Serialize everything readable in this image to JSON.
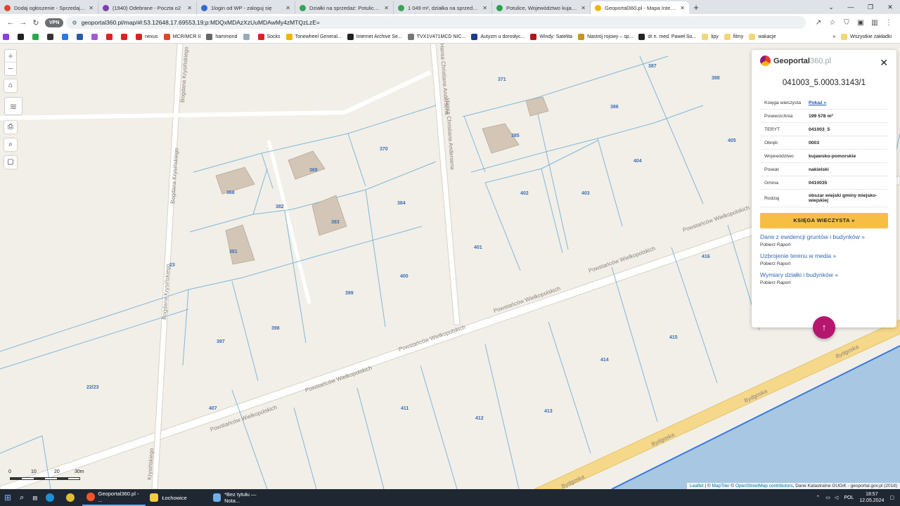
{
  "tabs": [
    {
      "title": "Dodaj ogłoszenie - Sprzedajemy",
      "color": "#e0472a"
    },
    {
      "title": "(1940) Odebrane - Poczta o2",
      "color": "#7a3fb0"
    },
    {
      "title": "1login od WP - zaloguj się",
      "color": "#2f6bd0"
    },
    {
      "title": "Działki na sprzedaż: Potulice, Na",
      "color": "#3aa35a"
    },
    {
      "title": "1 049 m², działka na sprzedaż -",
      "color": "#3aa35a"
    },
    {
      "title": "Potulice, Województwo kujawsk",
      "color": "#2aa44b"
    },
    {
      "title": "Geoportal360.pl - Mapa Interakt",
      "color": "#f4b400"
    }
  ],
  "address": "geoportal360.pl/map/#l:53.12648,17.69553,19;p:MDQxMDAzXzUuMDAwMy4zMTQzLzE=",
  "bookmarks": [
    "nexus",
    "MCR/MCR II",
    "hammond",
    "Socks",
    "Tonewheel General...",
    "Internet Archive Se...",
    "TVX1V471MCD NIC...",
    "Autyzm u dorosłyc...",
    "Windy: Satelita",
    "Nastrój rojowy – sp...",
    "dr n. med. Paweł So...",
    "lipy",
    "filmy",
    "wakacje",
    "Wszystkie zakładki"
  ],
  "map": {
    "plots": [
      "371",
      "387",
      "388",
      "386",
      "385",
      "405",
      "370",
      "369",
      "368",
      "404",
      "382",
      "384",
      "402",
      "403",
      "383",
      "401",
      "381",
      "23",
      "416",
      "400",
      "399",
      "398",
      "397",
      "415",
      "414",
      "22/23",
      "407",
      "411",
      "412",
      "413"
    ],
    "streets": [
      "Bogdana Krysińskiego",
      "Bogdana Krysińskiego",
      "Bogdana Krysińskiego",
      "Hansa Christiana Andersena",
      "Hansa Christiana Andersena",
      "Powstańców Wielkopolskich",
      "Powstańców Wielkopolskich",
      "Powstańców Wielkopolskich",
      "Powstańców Wielkopolskich",
      "Powstańców Wielkopolskich",
      "Powstańców Wielkopolskich",
      "Bydgoska",
      "Bydgoska",
      "Bydgoska",
      "Bydgoska",
      "Krysińskiego"
    ],
    "scale": [
      "0",
      "10",
      "20",
      "30m"
    ],
    "attribution": {
      "leaflet": "Leaflet",
      "mid": " | © ",
      "maptiler": "MapTiler",
      "mid2": " © ",
      "osm": "OpenStreetMap contributors",
      "rest": ", Dane Katastralne GUGiK - geoportal.gov.pl (2018)"
    }
  },
  "panel": {
    "logo": "Geoportal",
    "logo_num": "360",
    "logo_tld": ".pl",
    "id": "041003_5.0003.3143/1",
    "rows": [
      {
        "k": "Księga wieczysta",
        "v": "Pokaż »",
        "link": true
      },
      {
        "k": "Powierzchnia",
        "v": "199 578 m²"
      },
      {
        "k": "TERYT",
        "v": "041003_5"
      },
      {
        "k": "Obręb",
        "v": "0003"
      },
      {
        "k": "Województwo",
        "v": "kujawsko-pomorskie"
      },
      {
        "k": "Powiat",
        "v": "nakielski"
      },
      {
        "k": "Gmina",
        "v": "0410035"
      },
      {
        "k": "Rodzaj",
        "v": "obszar wiejski gminy miejsko-wiejskiej"
      }
    ],
    "button": "KSIĘGA WIECZYSTA »",
    "links": [
      {
        "title": "Dane z ewidencji gruntów i budynków »",
        "sub": "Pobierz Raport"
      },
      {
        "title": "Uzbrojenie terenu w media »",
        "sub": "Pobierz Raport"
      },
      {
        "title": "Wymiary działki i budynków »",
        "sub": "Pobierz Raport"
      }
    ]
  },
  "taskbar": {
    "apps": [
      "Geoportal360.pl - ...",
      "Łochowice",
      "*Bez tytułu — Nota..."
    ],
    "lang": "POL",
    "time": "18:57",
    "date": "12.05.2024"
  }
}
